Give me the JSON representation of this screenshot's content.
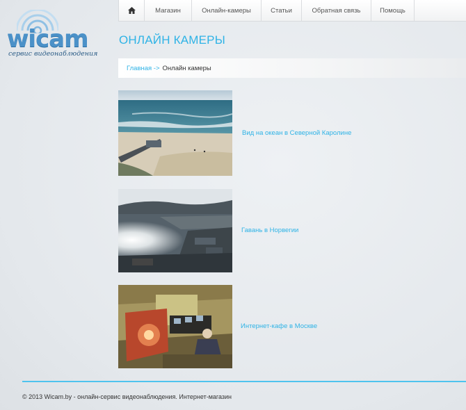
{
  "logo": {
    "text": "wicam",
    "tagline": "сервис видеонаблюдения"
  },
  "nav": {
    "home_icon": "home-icon",
    "items": [
      "Магазин",
      "Онлайн-камеры",
      "Статьи",
      "Обратная связь",
      "Помощь"
    ]
  },
  "page": {
    "title": "ОНЛАЙН КАМЕРЫ"
  },
  "breadcrumb": {
    "home": "Главная ->",
    "current": "Онлайн камеры"
  },
  "cameras": [
    {
      "label": "Вид на океан в Северной Каролине"
    },
    {
      "label": "Гавань в Норвегии"
    },
    {
      "label": "Интернет-кафе в Москве"
    }
  ],
  "footer": {
    "text": "© 2013 Wicam.by - онлайн-сервис видеонаблюдения. Интернет-магазин"
  },
  "colors": {
    "accent": "#2fb3e6",
    "logo": "#4b91c8",
    "footer_line": "#4ec3ee"
  }
}
